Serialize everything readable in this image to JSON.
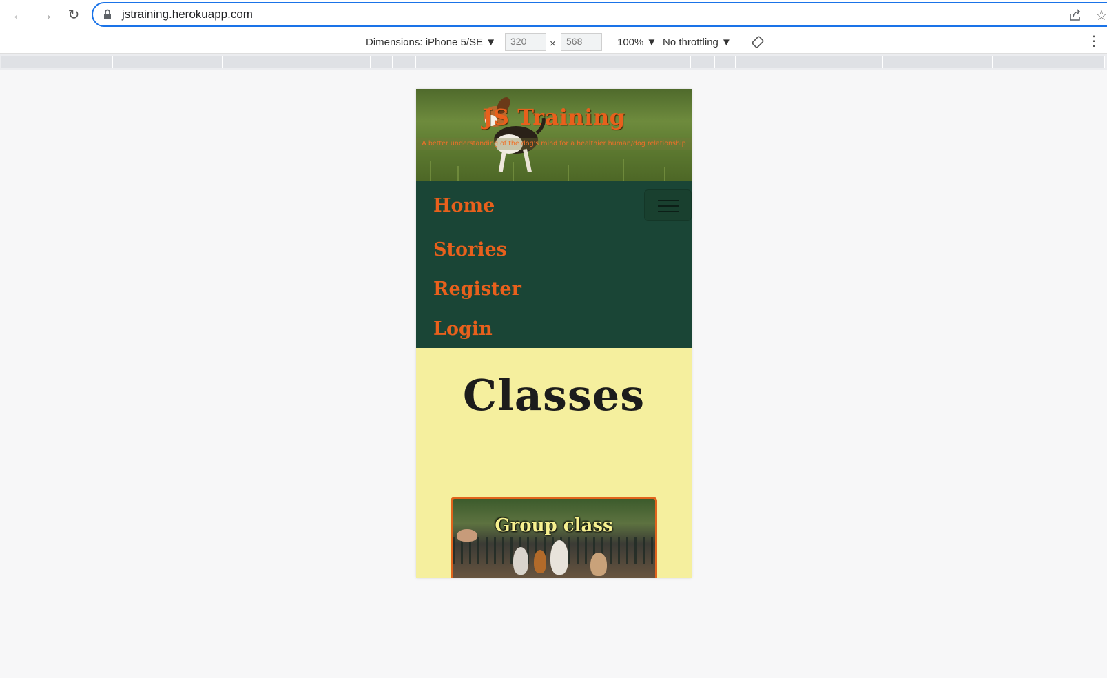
{
  "browser": {
    "url": "jstraining.herokuapp.com"
  },
  "devtools": {
    "dimensions_label": "Dimensions: iPhone 5/SE ▼",
    "width_value": "320",
    "height_value": "568",
    "times_sign": "×",
    "zoom": "100% ▼",
    "throttling": "No throttling ▼"
  },
  "site": {
    "title": "JS Training",
    "tagline": "A better understanding of the dog's mind for a healthier human/dog relationship",
    "nav": {
      "home": "Home",
      "stories": "Stories",
      "register": "Register",
      "login": "Login"
    },
    "section_title": "Classes",
    "cards": [
      {
        "title": "Group class"
      }
    ]
  },
  "colors": {
    "accent_orange": "#e8601c",
    "nav_green": "#1a4536",
    "page_yellow": "#f5ef9e",
    "url_focus": "#1a73e8"
  },
  "icons": [
    "back-arrow-icon",
    "forward-arrow-icon",
    "reload-icon",
    "lock-icon",
    "share-icon",
    "bookmark-star-icon",
    "rotate-icon",
    "more-options-icon",
    "hamburger-icon"
  ]
}
